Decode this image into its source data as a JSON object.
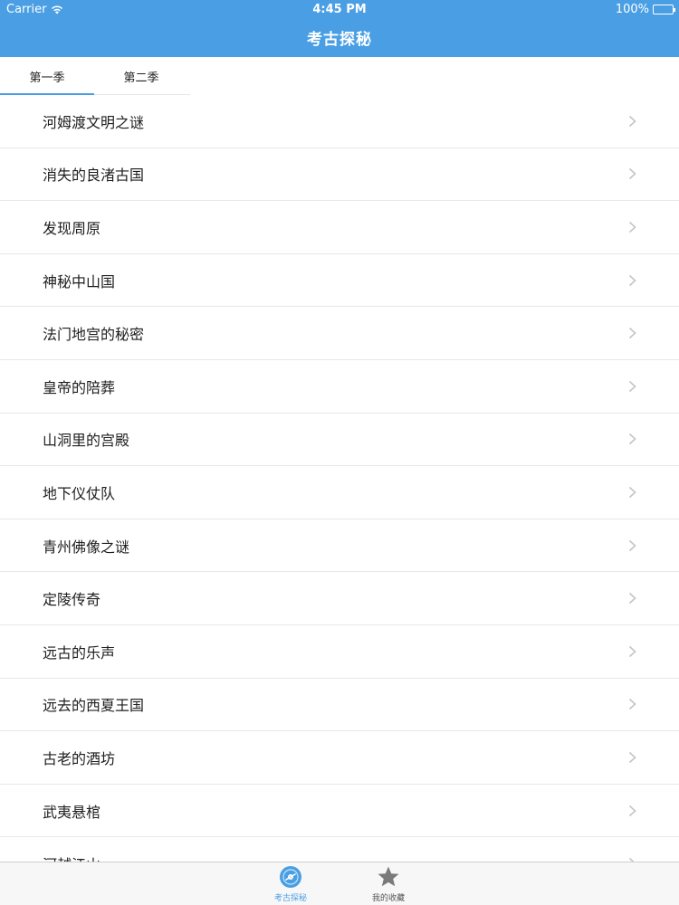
{
  "status_bar": {
    "carrier": "Carrier",
    "time": "4:45 PM",
    "battery": "100%"
  },
  "nav": {
    "title": "考古探秘"
  },
  "segments": [
    {
      "label": "第一季",
      "active": true
    },
    {
      "label": "第二季",
      "active": false
    }
  ],
  "episodes": [
    "河姆渡文明之谜",
    "消失的良渚古国",
    "发现周原",
    "神秘中山国",
    "法门地宫的秘密",
    "皇帝的陪葬",
    "山洞里的宫殿",
    "地下仪仗队",
    "青州佛像之谜",
    "定陵传奇",
    "远古的乐声",
    "远去的西夏王国",
    "古老的酒坊",
    "武夷悬棺",
    "河越江山"
  ],
  "tabbar": {
    "items": [
      {
        "label": "考古探秘",
        "icon": "disc-icon",
        "active": true
      },
      {
        "label": "我的收藏",
        "icon": "star-icon",
        "active": false
      }
    ]
  },
  "colors": {
    "accent": "#4a9fe4",
    "separator": "#e8e8e8",
    "tabbar_bg": "#f7f7f8",
    "inactive_icon": "#7a7a7a"
  }
}
